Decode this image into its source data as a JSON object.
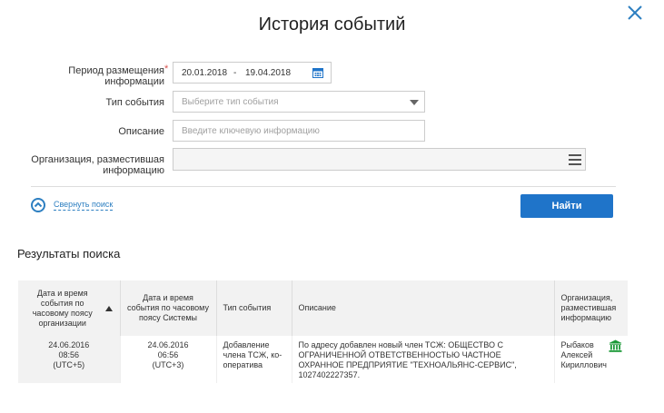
{
  "dialog": {
    "title": "История событий"
  },
  "form": {
    "period_label": "Период размещения информации",
    "required_mark": "*",
    "period_from": "20.01.2018",
    "period_sep": "-",
    "period_to": "19.04.2018",
    "type_label": "Тип события",
    "type_placeholder": "Выберите тип события",
    "desc_label": "Описание",
    "desc_placeholder": "Введите ключевую информацию",
    "org_label": "Организация, разместившая информацию",
    "org_value": ""
  },
  "actions": {
    "collapse_label": "Свернуть поиск",
    "find_label": "Найти"
  },
  "results": {
    "title": "Результаты поиска",
    "columns": [
      "Дата и время события по часовому поясу организации",
      "Дата и время события по часовому поясу Системы",
      "Тип события",
      "Описание",
      "Организация, разместившая информацию"
    ],
    "rows": [
      {
        "org_date": "24.06.2016",
        "org_time": "08:56",
        "org_tz": "(UTC+5)",
        "sys_date": "24.06.2016",
        "sys_time": "06:56",
        "sys_tz": "(UTC+3)",
        "type": "Добавление члена ТСЖ, ко-оператива",
        "description": "По адресу добавлен новый член ТСЖ: ОБЩЕСТВО С ОГРАНИЧЕННОЙ ОТВЕТСТВЕННОСТЬЮ ЧАСТНОЕ ОХРАННОЕ ПРЕДПРИЯТИЕ \"ТЕХНОАЛЬЯНС-СЕРВИС\", 1027402227357.",
        "organization": "Рыбаков Алексей Кириллович"
      }
    ]
  },
  "colors": {
    "accent": "#1f74c9",
    "link": "#2d7fc1",
    "bank_icon": "#1e9b3a",
    "required": "#d9534f"
  },
  "icons": {
    "close": "close-icon",
    "calendar": "calendar-icon",
    "dropdown": "chevron-down-icon",
    "list": "menu-icon",
    "collapse": "chevron-up-icon",
    "sort": "sort-asc-icon",
    "org_type": "bank-icon"
  }
}
